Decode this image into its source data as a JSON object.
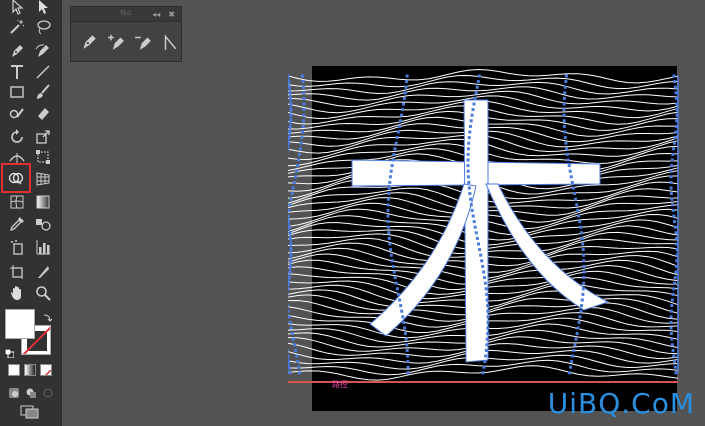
{
  "panel": {
    "title": "锚点"
  },
  "artwork": {
    "path_label": "路径"
  },
  "watermark": {
    "text": "UiBQ.CoM"
  },
  "colors": {
    "toolbar_bg": "#323232",
    "canvas_bg": "#535353",
    "artboard": "#000000",
    "lines": "#ffffff",
    "anchors": "#4a7bdf",
    "highlight": "#e03030",
    "watermark": "#2b8fe0"
  },
  "tools": [
    "selection-icon",
    "direct-selection-icon",
    "magic-wand-icon",
    "lasso-icon",
    "pen-icon",
    "curvature-icon",
    "type-icon",
    "line-icon",
    "rectangle-icon",
    "paintbrush-icon",
    "shaper-icon",
    "eraser-icon",
    "rotate-icon",
    "scale-icon",
    "width-icon",
    "free-transform-icon",
    "shape-builder-icon",
    "perspective-grid-icon",
    "mesh-icon",
    "gradient-icon",
    "eyedropper-icon",
    "blend-icon",
    "symbol-sprayer-icon",
    "column-graph-icon",
    "artboard-icon",
    "slice-icon",
    "hand-icon",
    "zoom-icon"
  ]
}
